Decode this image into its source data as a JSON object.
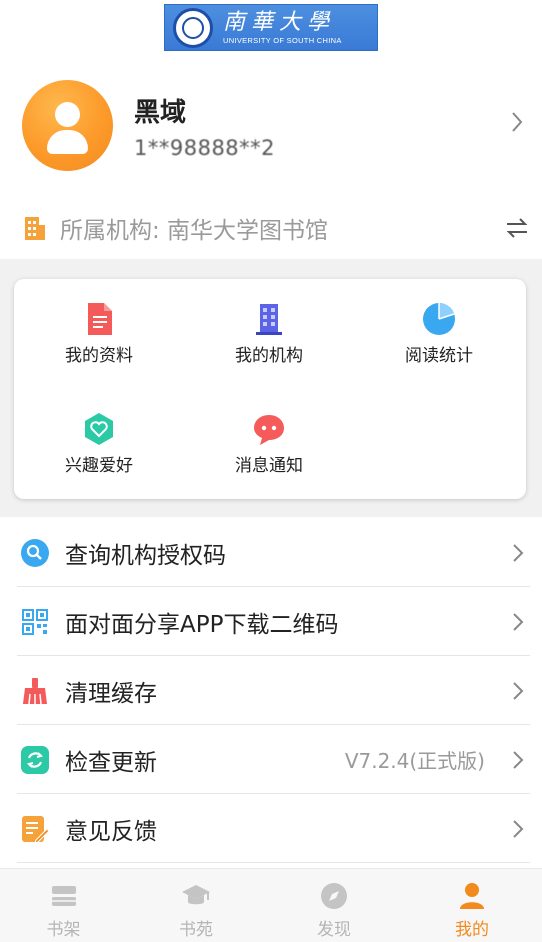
{
  "logo": {
    "name_cn": "南華大學",
    "name_en": "UNIVERSITY OF SOUTH CHINA"
  },
  "profile": {
    "name": "黑域",
    "phone": "1**98888**2"
  },
  "institution": {
    "label": "所属机构: 南华大学图书馆",
    "icon": "building-icon"
  },
  "grid": [
    {
      "label": "我的资料",
      "icon": "document-icon",
      "color": "#f45a5a"
    },
    {
      "label": "我的机构",
      "icon": "building-icon",
      "color": "#5b63e6"
    },
    {
      "label": "阅读统计",
      "icon": "pie-chart-icon",
      "color": "#3aa8f0"
    },
    {
      "label": "兴趣爱好",
      "icon": "heart-hexagon-icon",
      "color": "#2cc9a6"
    },
    {
      "label": "消息通知",
      "icon": "chat-bubble-icon",
      "color": "#f55b5b"
    }
  ],
  "menu": [
    {
      "label": "查询机构授权码",
      "icon": "search-icon",
      "value": ""
    },
    {
      "label": "面对面分享APP下载二维码",
      "icon": "qr-code-icon",
      "value": ""
    },
    {
      "label": "清理缓存",
      "icon": "broom-icon",
      "value": ""
    },
    {
      "label": "检查更新",
      "icon": "refresh-icon",
      "value": "V7.2.4(正式版)"
    },
    {
      "label": "意见反馈",
      "icon": "feedback-icon",
      "value": ""
    }
  ],
  "tabs": [
    {
      "label": "书架",
      "icon": "bookshelf-icon",
      "active": false
    },
    {
      "label": "书苑",
      "icon": "graduation-cap-icon",
      "active": false
    },
    {
      "label": "发现",
      "icon": "compass-icon",
      "active": false
    },
    {
      "label": "我的",
      "icon": "person-icon",
      "active": true
    }
  ],
  "colors": {
    "accent": "#f28b1e",
    "inactive_tab": "#b5b5b5"
  }
}
